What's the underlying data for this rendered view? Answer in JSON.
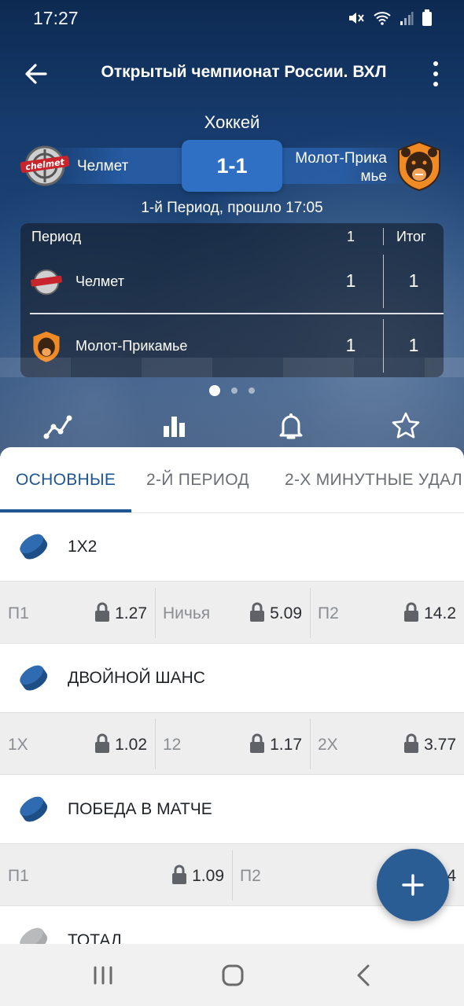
{
  "status_bar": {
    "time": "17:27"
  },
  "header": {
    "title": "Открытый чемпионат России. ВХЛ"
  },
  "match": {
    "sport": "Хоккей",
    "home_team": "Челмет",
    "away_team": "Молот-Прика\nмье",
    "score": "1-1",
    "period_info": "1-й Период, прошло 17:05"
  },
  "period_table": {
    "header_label": "Период",
    "period_col": "1",
    "total_col": "Итог",
    "rows": [
      {
        "team": "Челмет",
        "p1": "1",
        "total": "1"
      },
      {
        "team": "Молот-Прикамье",
        "p1": "1",
        "total": "1"
      }
    ]
  },
  "tabs": [
    {
      "label": "ОСНОВНЫЕ",
      "active": true
    },
    {
      "label": "2-Й ПЕРИОД",
      "active": false
    },
    {
      "label": "2-Х МИНУТНЫЕ УДАЛ",
      "active": false
    }
  ],
  "markets": [
    {
      "title": "1X2",
      "odds": [
        {
          "label": "П1",
          "value": "1.27",
          "locked": true
        },
        {
          "label": "Ничья",
          "value": "5.09",
          "locked": true
        },
        {
          "label": "П2",
          "value": "14.2",
          "locked": true
        }
      ]
    },
    {
      "title": "ДВОЙНОЙ ШАНС",
      "odds": [
        {
          "label": "1X",
          "value": "1.02",
          "locked": true
        },
        {
          "label": "12",
          "value": "1.17",
          "locked": true
        },
        {
          "label": "2X",
          "value": "3.77",
          "locked": true
        }
      ]
    },
    {
      "title": "ПОБЕДА В МАТЧЕ",
      "odds": [
        {
          "label": "П1",
          "value": "1.09",
          "locked": true
        },
        {
          "label": "П2",
          "value": "4",
          "locked": true
        }
      ]
    },
    {
      "title": "ТОТАЛ"
    }
  ],
  "colors": {
    "accent": "#1e5593",
    "fab": "#2a5d94",
    "score_box": "#2f6fc4",
    "hero_bg": "#163a6b",
    "odds_row_bg": "#eeeeee"
  },
  "icons": {
    "actions": [
      "chart-line-icon",
      "bar-chart-icon",
      "bell-icon",
      "star-icon"
    ],
    "fab": "plus-icon",
    "market": "hockey-puck-icon",
    "nav": [
      "recent-apps-icon",
      "home-icon",
      "back-icon"
    ]
  }
}
